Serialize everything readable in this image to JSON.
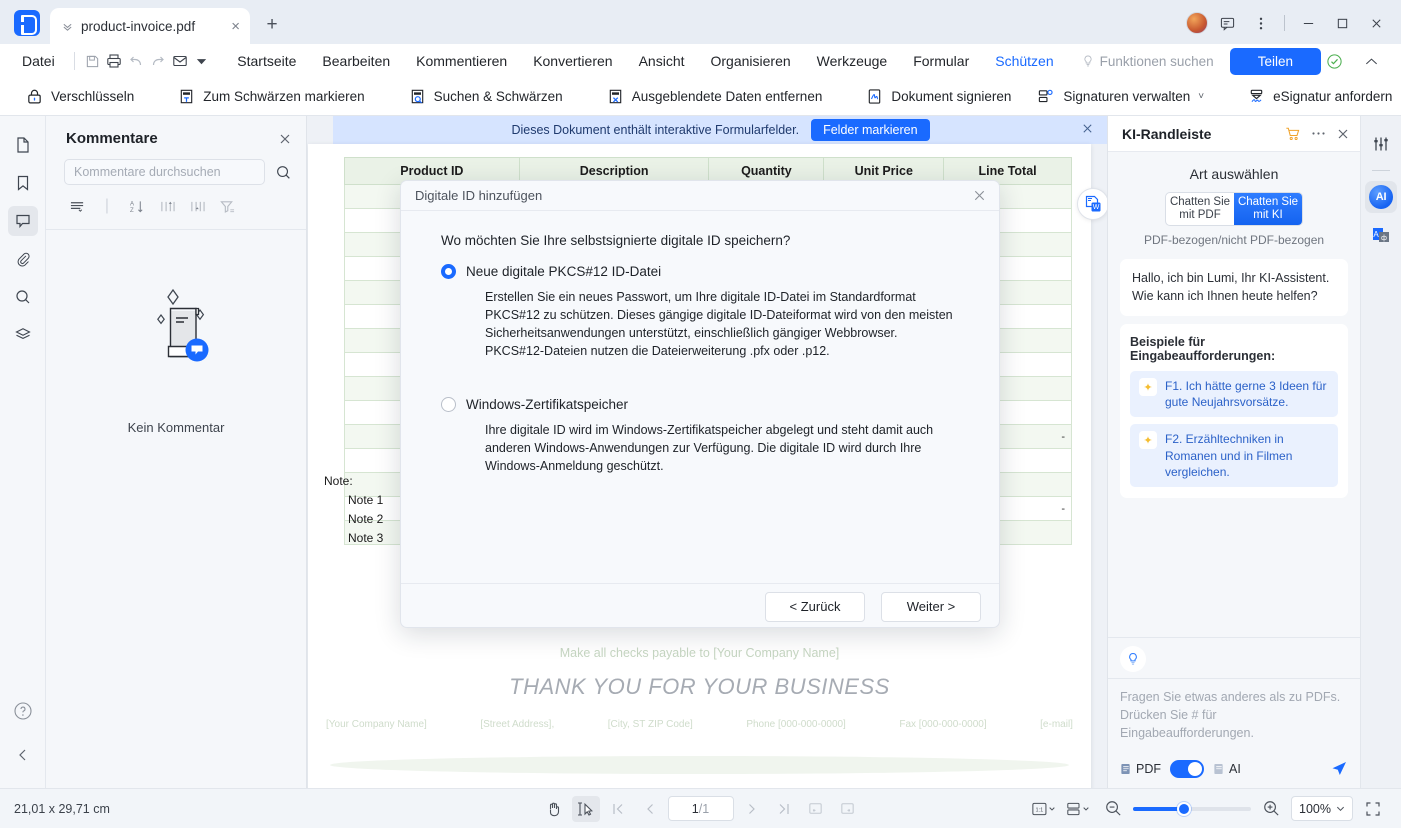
{
  "titlebar": {
    "tab_title": "product-invoice.pdf",
    "new_tab_label": "+",
    "close_tab_label": "×",
    "chevron_label": "ˇˇ",
    "icons": [
      "avatar",
      "feedback-icon",
      "more-icon",
      "minimize-icon",
      "maximize-icon",
      "close-icon"
    ]
  },
  "menubar": {
    "file_label": "Datei",
    "quick_actions": [
      "save-icon",
      "print-icon",
      "undo-icon",
      "redo-icon",
      "mail-icon",
      "dropdown-icon"
    ],
    "items": [
      {
        "label": "Startseite",
        "active": false
      },
      {
        "label": "Bearbeiten",
        "active": false
      },
      {
        "label": "Kommentieren",
        "active": false
      },
      {
        "label": "Konvertieren",
        "active": false
      },
      {
        "label": "Ansicht",
        "active": false
      },
      {
        "label": "Organisieren",
        "active": false
      },
      {
        "label": "Werkzeuge",
        "active": false
      },
      {
        "label": "Formular",
        "active": false
      },
      {
        "label": "Schützen",
        "active": true
      }
    ],
    "search_label": "Funktionen suchen",
    "share_label": "Teilen"
  },
  "ribbon": {
    "items": [
      {
        "label": "Verschlüsseln",
        "icon": "lock-icon"
      },
      {
        "label": "Zum Schwärzen markieren",
        "icon": "redact-mark-icon"
      },
      {
        "label": "Suchen & Schwärzen",
        "icon": "redact-search-icon"
      },
      {
        "label": "Ausgeblendete Daten entfernen",
        "icon": "remove-hidden-data-icon"
      },
      {
        "label": "Dokument signieren",
        "icon": "sign-document-icon"
      },
      {
        "label": "Signaturen verwalten",
        "icon": "manage-signatures-icon",
        "caret": "˅"
      },
      {
        "label": "eSignatur anfordern",
        "icon": "esignature-icon"
      }
    ]
  },
  "left_rail": {
    "icons": [
      {
        "name": "thumbnails-icon",
        "selected": false
      },
      {
        "name": "bookmark-icon",
        "selected": false
      },
      {
        "name": "comments-icon",
        "selected": true
      },
      {
        "name": "attachment-icon",
        "selected": false
      },
      {
        "name": "search-icon",
        "selected": false
      },
      {
        "name": "layers-icon",
        "selected": false
      }
    ],
    "bottom_icons": [
      {
        "name": "help-icon"
      },
      {
        "name": "collapse-icon"
      }
    ]
  },
  "comments_panel": {
    "title": "Kommentare",
    "search_placeholder": "Kommentare durchsuchen",
    "tools": [
      "list-view-icon",
      "sort-az-icon",
      "sort-asc-icon",
      "sort-desc-icon",
      "filter-icon"
    ],
    "empty_label": "Kein Kommentar"
  },
  "banner": {
    "text": "Dieses Dokument enthält interaktive Formularfelder.",
    "button_label": "Felder markieren"
  },
  "document": {
    "table_headers": [
      "Product ID",
      "Description",
      "Quantity",
      "Unit Price",
      "Line Total"
    ],
    "dash_cell": "-",
    "note_label": "Note:",
    "notes": [
      "Note 1",
      "Note 2",
      "Note 3"
    ],
    "payable_text": "Make all checks payable to [Your Company Name]",
    "thanks_text": "THANK YOU FOR YOUR BUSINESS",
    "footer": [
      "[Your Company Name]",
      "[Street Address],",
      "[City, ST ZIP Code]",
      "Phone [000-000-0000]",
      "Fax [000-000-0000]",
      "[e-mail]"
    ]
  },
  "dialog": {
    "title": "Digitale ID hinzufügen",
    "close_label": "✕",
    "question": "Wo möchten Sie Ihre selbstsignierte digitale ID speichern?",
    "option1_label": "Neue digitale PKCS#12 ID-Datei",
    "option1_desc": "Erstellen Sie ein neues Passwort, um Ihre digitale ID-Datei im Standardformat PKCS#12 zu schützen. Dieses gängige digitale ID-Dateiformat wird von den meisten Sicherheitsanwendungen unterstützt, einschließlich gängiger Webbrowser. PKCS#12-Dateien nutzen die Dateierweiterung .pfx oder .p12.",
    "option2_label": "Windows-Zertifikatspeicher",
    "option2_desc": "Ihre digitale ID wird im Windows-Zertifikatspeicher abgelegt und steht damit auch anderen Windows-Anwendungen zur Verfügung. Die digitale ID wird durch Ihre Windows-Anmeldung geschützt.",
    "back_label": "< Zurück",
    "next_label": "Weiter >",
    "selected_option": 1
  },
  "ai_sidebar": {
    "title": "KI-Randleiste",
    "head_icons": [
      "cart-icon",
      "more-icon",
      "close-icon"
    ],
    "kind_label": "Art auswählen",
    "seg_left": "Chatten Sie mit PDF",
    "seg_right": "Chatten Sie mit KI",
    "seg_caption": "PDF-bezogen/nicht PDF-bezogen",
    "greeting": "Hallo, ich bin Lumi, Ihr KI-Assistent. Wie kann ich Ihnen heute helfen?",
    "prompts_header": "Beispiele für Eingabeaufforderungen:",
    "prompts": [
      "F1. Ich hätte gerne 3 Ideen für gute Neujahrsvorsätze.",
      "F2. Erzähltechniken in Romanen und in Filmen vergleichen."
    ],
    "input_placeholder": "Fragen Sie etwas anderes als zu PDFs. Drücken Sie # für Eingabeaufforderungen.",
    "chip_pdf": "PDF",
    "chip_ai": "AI",
    "toggle_on": true
  },
  "right_rail": {
    "icons": [
      {
        "name": "settings-sliders-icon",
        "selected": false
      },
      {
        "name": "ai-assistant-icon",
        "selected": true,
        "label": "AI"
      },
      {
        "name": "translate-icon",
        "selected": false
      }
    ]
  },
  "status_bar": {
    "dimensions": "21,01 x 29,71 cm",
    "page_current": "1",
    "page_total": "/1",
    "zoom_level": "100%",
    "left_tools": [
      "hand-tool-icon",
      "select-tool-icon",
      "first-page-icon",
      "prev-page-icon"
    ],
    "right_nav": [
      "next-page-icon",
      "last-page-icon",
      "fit-page-icon",
      "fit-width-icon"
    ],
    "view_tools": [
      "page-layout-icon",
      "scroll-mode-icon",
      "zoom-out-icon",
      "zoom-in-icon",
      "fullscreen-icon"
    ]
  },
  "colors": {
    "accent": "#1a6aff",
    "banner_bg": "#d6e4ff",
    "panel_bg": "#f5f7fa"
  }
}
